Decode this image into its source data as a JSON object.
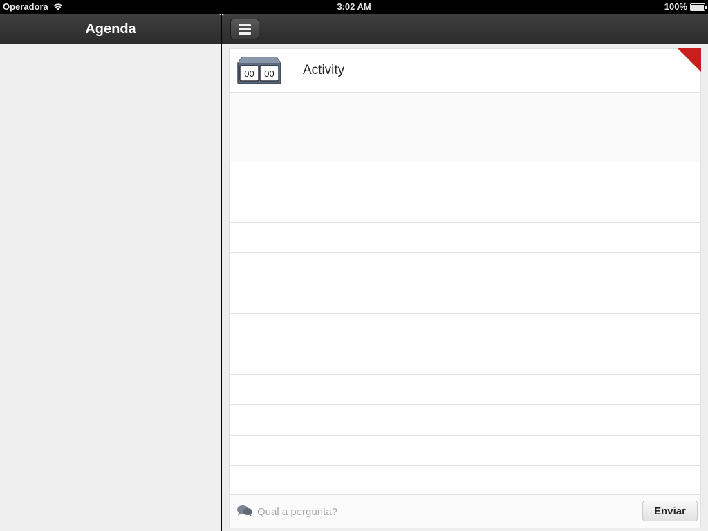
{
  "status_bar": {
    "carrier": "Operadora",
    "time": "3:02 AM",
    "battery": "100%"
  },
  "left_pane": {
    "title": "Agenda"
  },
  "right_pane": {
    "menu_icon": "hamburger-menu-icon",
    "activity": {
      "title": "Activity",
      "clock_left": "00",
      "clock_right": "00",
      "flag_color": "#c81e1e"
    },
    "input": {
      "placeholder": "Qual a pergunta?",
      "value": "",
      "send_label": "Enviar"
    }
  }
}
